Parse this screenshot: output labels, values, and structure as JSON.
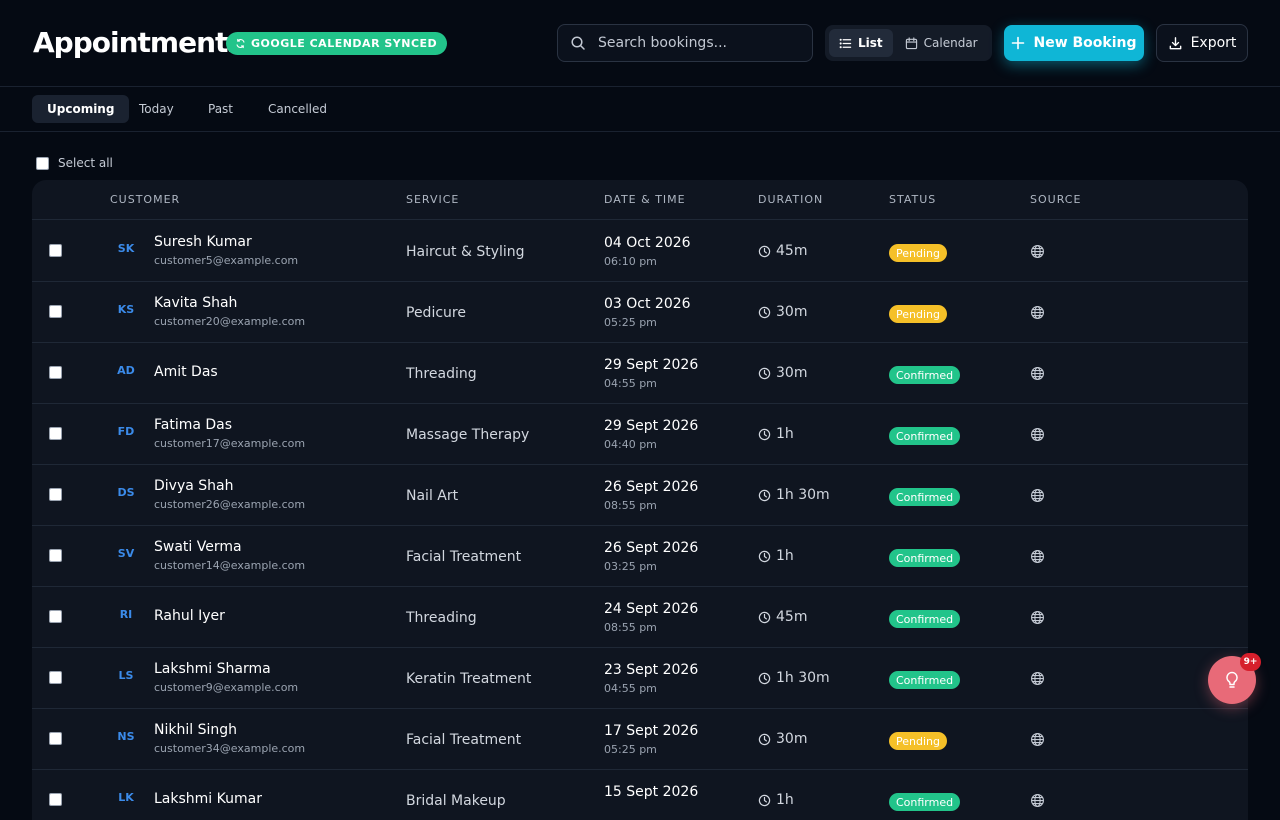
{
  "header": {
    "title": "Appointments",
    "sync_badge": "GOOGLE CALENDAR SYNCED",
    "search_placeholder": "Search bookings...",
    "view_list": "List",
    "view_calendar": "Calendar",
    "new_booking": "New Booking",
    "export": "Export"
  },
  "tabs": [
    {
      "label": "Upcoming",
      "active": true
    },
    {
      "label": "Today",
      "active": false
    },
    {
      "label": "Past",
      "active": false
    },
    {
      "label": "Cancelled",
      "active": false
    }
  ],
  "select_all": "Select all",
  "columns": {
    "customer": "CUSTOMER",
    "service": "SERVICE",
    "datetime": "DATE & TIME",
    "duration": "DURATION",
    "status": "STATUS",
    "source": "SOURCE"
  },
  "rows": [
    {
      "initials": "SK",
      "name": "Suresh Kumar",
      "email": "customer5@example.com",
      "service": "Haircut & Styling",
      "date": "04 Oct 2026",
      "time": "06:10 pm",
      "duration": "45m",
      "status": "Pending"
    },
    {
      "initials": "KS",
      "name": "Kavita Shah",
      "email": "customer20@example.com",
      "service": "Pedicure",
      "date": "03 Oct 2026",
      "time": "05:25 pm",
      "duration": "30m",
      "status": "Pending"
    },
    {
      "initials": "AD",
      "name": "Amit Das",
      "email": "",
      "service": "Threading",
      "date": "29 Sept 2026",
      "time": "04:55 pm",
      "duration": "30m",
      "status": "Confirmed"
    },
    {
      "initials": "FD",
      "name": "Fatima Das",
      "email": "customer17@example.com",
      "service": "Massage Therapy",
      "date": "29 Sept 2026",
      "time": "04:40 pm",
      "duration": "1h",
      "status": "Confirmed"
    },
    {
      "initials": "DS",
      "name": "Divya Shah",
      "email": "customer26@example.com",
      "service": "Nail Art",
      "date": "26 Sept 2026",
      "time": "08:55 pm",
      "duration": "1h 30m",
      "status": "Confirmed"
    },
    {
      "initials": "SV",
      "name": "Swati Verma",
      "email": "customer14@example.com",
      "service": "Facial Treatment",
      "date": "26 Sept 2026",
      "time": "03:25 pm",
      "duration": "1h",
      "status": "Confirmed"
    },
    {
      "initials": "RI",
      "name": "Rahul Iyer",
      "email": "",
      "service": "Threading",
      "date": "24 Sept 2026",
      "time": "08:55 pm",
      "duration": "45m",
      "status": "Confirmed"
    },
    {
      "initials": "LS",
      "name": "Lakshmi Sharma",
      "email": "customer9@example.com",
      "service": "Keratin Treatment",
      "date": "23 Sept 2026",
      "time": "04:55 pm",
      "duration": "1h 30m",
      "status": "Confirmed"
    },
    {
      "initials": "NS",
      "name": "Nikhil Singh",
      "email": "customer34@example.com",
      "service": "Facial Treatment",
      "date": "17 Sept 2026",
      "time": "05:25 pm",
      "duration": "30m",
      "status": "Pending"
    },
    {
      "initials": "LK",
      "name": "Lakshmi Kumar",
      "email": "",
      "service": "Bridal Makeup",
      "date": "15 Sept 2026",
      "time": "",
      "duration": "1h",
      "status": "Confirmed"
    }
  ],
  "notifications": {
    "badge": "9+"
  },
  "colors": {
    "accent": "#0fb6d6",
    "confirmed": "#22c48a",
    "pending": "#f5c028",
    "fab": "#e86a78"
  }
}
